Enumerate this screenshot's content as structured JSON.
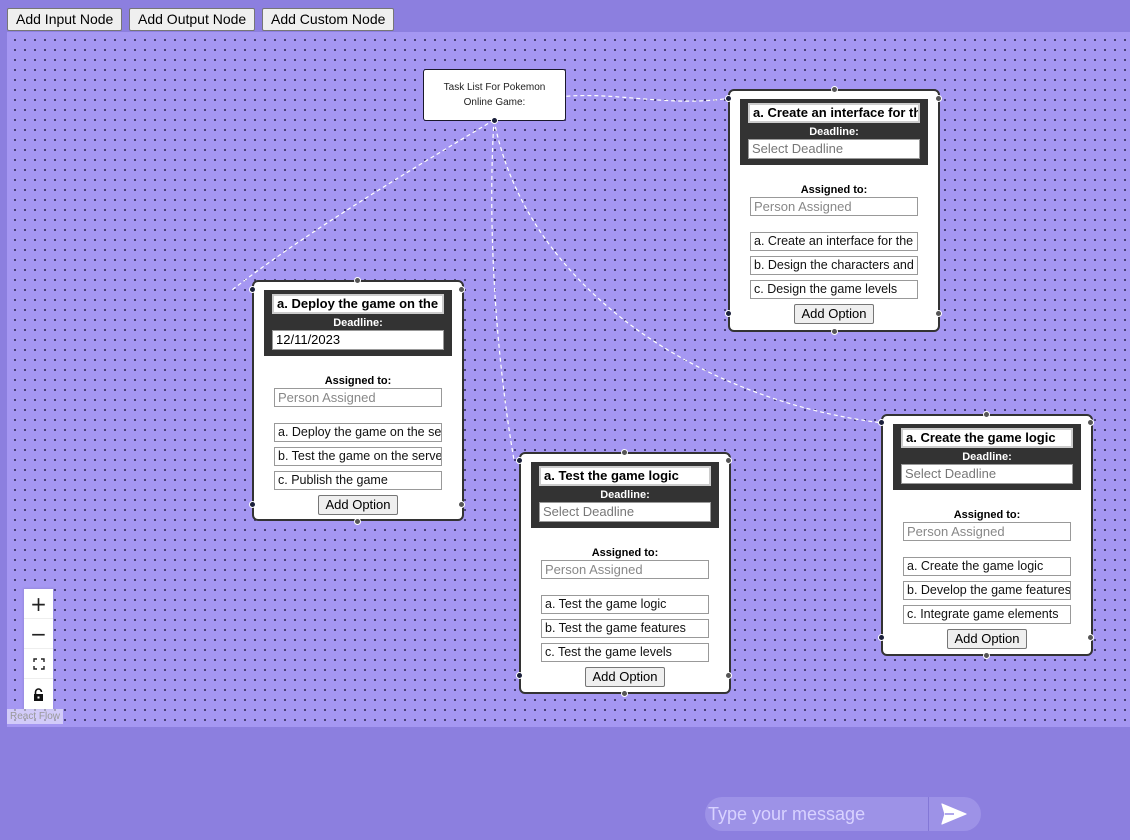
{
  "toolbar": {
    "add_input": "Add Input Node",
    "add_output": "Add Output Node",
    "add_custom": "Add Custom Node"
  },
  "input_node": {
    "label": "Task List For Pokemon Online Game:"
  },
  "nodes": [
    {
      "title": "a. Deploy the game on the s",
      "deadline_label": "Deadline:",
      "deadline_value": "12/11/2023",
      "assigned_label": "Assigned to:",
      "person_placeholder": "Person Assigned",
      "options": [
        "a. Deploy the game on the se",
        "b. Test the game on the serve",
        "c. Publish the game"
      ],
      "add_option": "Add Option"
    },
    {
      "title": "a. Create an interface for the",
      "deadline_label": "Deadline:",
      "deadline_placeholder": "Select Deadline",
      "assigned_label": "Assigned to:",
      "person_placeholder": "Person Assigned",
      "options": [
        "a. Create an interface for the",
        "b. Design the characters and",
        "c. Design the game levels"
      ],
      "add_option": "Add Option"
    },
    {
      "title": "a. Test the game logic",
      "deadline_label": "Deadline:",
      "deadline_placeholder": "Select Deadline",
      "assigned_label": "Assigned to:",
      "person_placeholder": "Person Assigned",
      "options": [
        "a. Test the game logic",
        "b. Test the game features",
        "c. Test the game levels"
      ],
      "add_option": "Add Option"
    },
    {
      "title": "a. Create the game logic",
      "deadline_label": "Deadline:",
      "deadline_placeholder": "Select Deadline",
      "assigned_label": "Assigned to:",
      "person_placeholder": "Person Assigned",
      "options": [
        "a. Create the game logic",
        "b. Develop the game features",
        "c. Integrate game elements"
      ],
      "add_option": "Add Option"
    }
  ],
  "controls": {
    "zoom_in": "+",
    "zoom_out": "−"
  },
  "attribution": "React Flow",
  "chat": {
    "placeholder": "Type your message"
  },
  "colors": {
    "page_bg": "#8c7fdf",
    "canvas_bg": "#a597f2",
    "node_header": "#333333"
  }
}
